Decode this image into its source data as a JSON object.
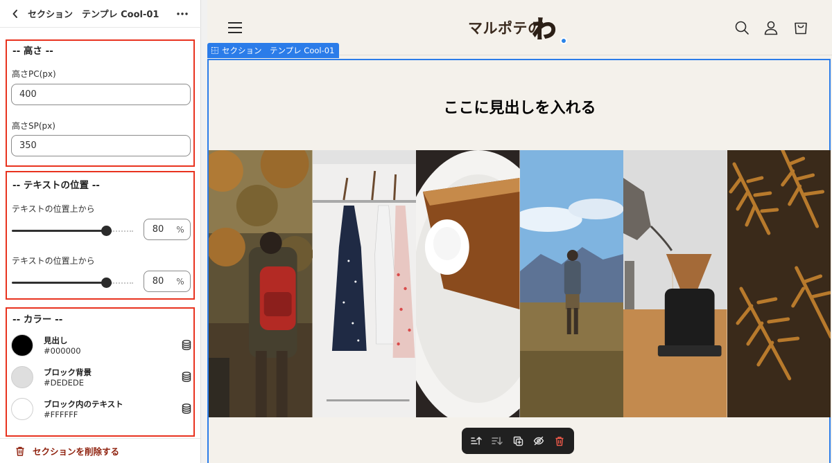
{
  "editor": {
    "title": "セクション　テンプレ Cool-01",
    "height_group": {
      "title": "-- 高さ --",
      "pc_label": "高さPC(px)",
      "pc_value": "400",
      "sp_label": "高さSP(px)",
      "sp_value": "350"
    },
    "position_group": {
      "title": "-- テキストの位置 --",
      "sliders": [
        {
          "label": "テキストの位置上から",
          "value": "80",
          "unit": "%",
          "fraction": 0.8
        },
        {
          "label": "テキストの位置上から",
          "value": "80",
          "unit": "%",
          "fraction": 0.8
        }
      ]
    },
    "color_group": {
      "title": "-- カラー --",
      "colors": [
        {
          "name": "見出し",
          "hex": "#000000",
          "swatch": "#000000"
        },
        {
          "name": "ブロック背景",
          "hex": "#DEDEDE",
          "swatch": "#DEDEDE"
        },
        {
          "name": "ブロック内のテキスト",
          "hex": "#FFFFFF",
          "swatch": "#FFFFFF"
        }
      ]
    },
    "delete_label": "セクションを削除する",
    "accent_color": "#e8321e",
    "danger_color": "#8e1f0b"
  },
  "preview": {
    "logo_text": "マルポテの",
    "logo_mark": "わ",
    "section_tab_label": "セクション　テンプレ Cool-01",
    "heading": "ここに見出しを入れる",
    "selection_color": "#2b7ce9",
    "header_icons": [
      "search-icon",
      "account-icon",
      "cart-icon"
    ],
    "gallery": [
      {
        "subject": "hiker-autumn-forest"
      },
      {
        "subject": "dresses-on-rack"
      },
      {
        "subject": "pie-with-cream"
      },
      {
        "subject": "hiker-mountains"
      },
      {
        "subject": "coffee-pour-over"
      },
      {
        "subject": "autumn-fern-leaves"
      }
    ],
    "toolbar_icons": [
      "move-up-icon",
      "move-down-icon",
      "duplicate-icon",
      "hide-icon",
      "delete-icon"
    ]
  }
}
